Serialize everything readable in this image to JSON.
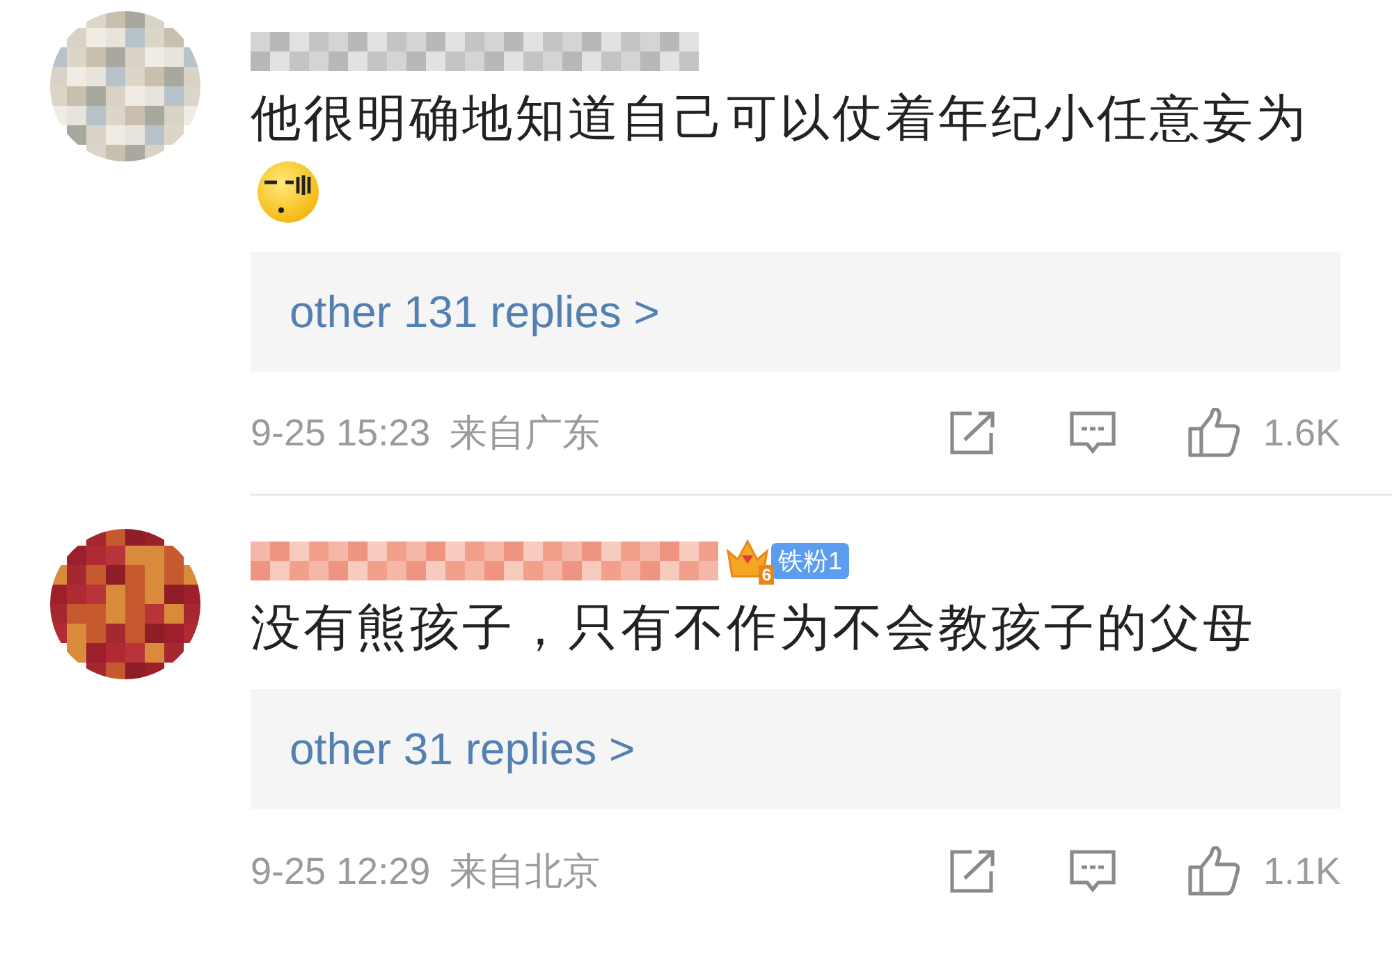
{
  "comments": [
    {
      "text": "他很明确地知道自己可以仗着年纪小任意妄为",
      "has_emoji": true,
      "replies": "other 131 replies >",
      "time": "9-25 15:23",
      "location": "来自广东",
      "likes": "1.6K"
    },
    {
      "badge": {
        "level": "6",
        "label": "铁粉1"
      },
      "text": "没有熊孩子，只有不作为不会教孩子的父母",
      "has_emoji": false,
      "replies": "other 31 replies >",
      "time": "9-25 12:29",
      "location": "来自北京",
      "likes": "1.1K"
    }
  ]
}
